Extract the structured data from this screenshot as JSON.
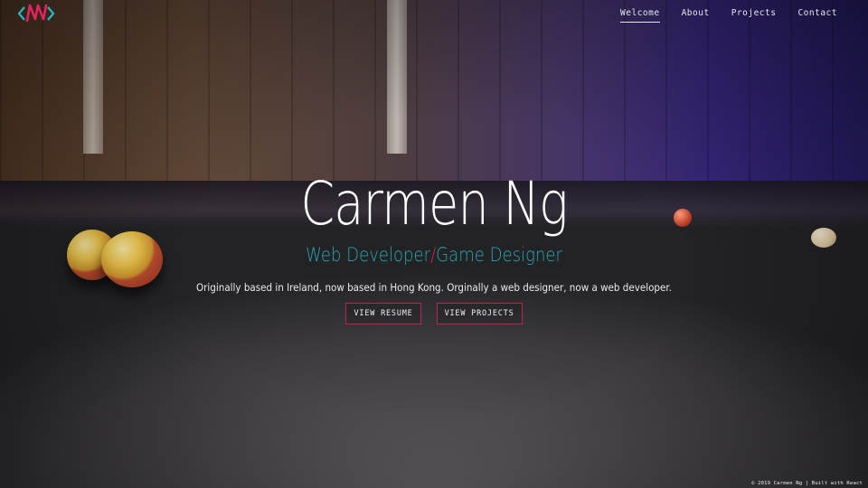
{
  "brand": {
    "logo_icon": "nn-monogram-logo",
    "accent_pink": "#e0245e",
    "accent_teal": "#26a6b0"
  },
  "nav": {
    "items": [
      {
        "label": "Welcome",
        "active": true
      },
      {
        "label": "About",
        "active": false
      },
      {
        "label": "Projects",
        "active": false
      },
      {
        "label": "Contact",
        "active": false
      }
    ]
  },
  "hero": {
    "name": "Carmen Ng",
    "role_primary": "Web Developer",
    "role_separator": "/",
    "role_secondary": "Game Designer",
    "tagline": "Originally based in Ireland, now based in Hong Kong. Orginally a web designer, now a web developer.",
    "buttons": {
      "resume": "VIEW RESUME",
      "projects": "VIEW PROJECTS"
    }
  },
  "footer": {
    "text": "© 2019 Carmen Ng | Built with React"
  }
}
